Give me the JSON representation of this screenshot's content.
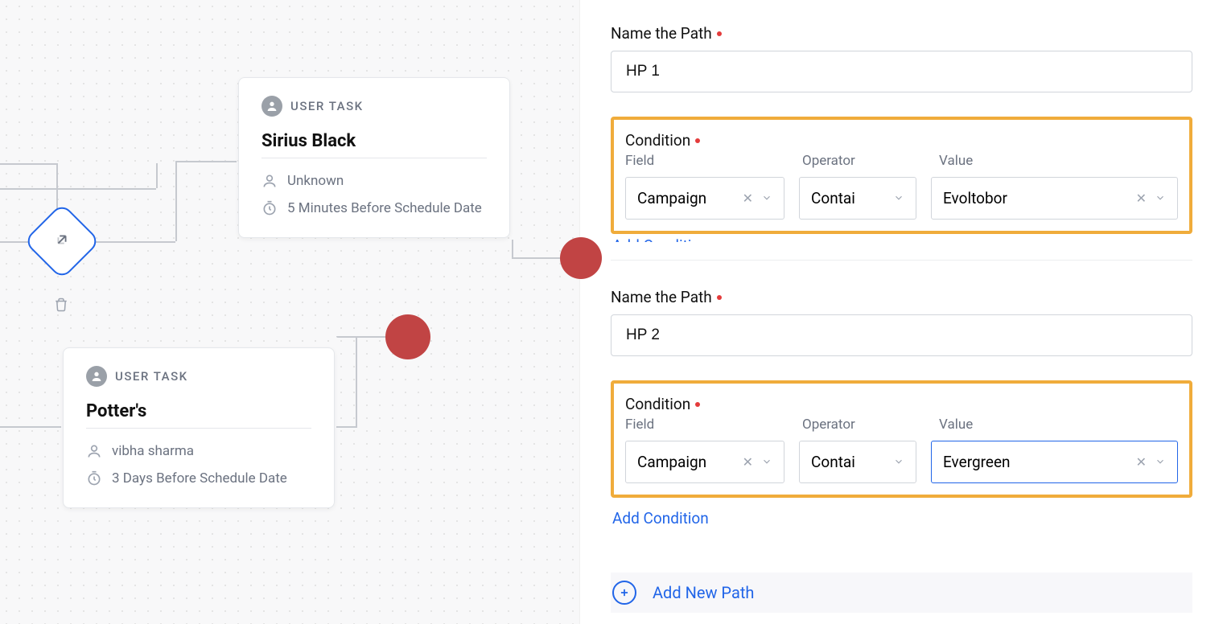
{
  "canvas": {
    "task1": {
      "type_label": "USER TASK",
      "title": "Sirius Black",
      "assignee": "Unknown",
      "timing": "5 Minutes Before Schedule Date"
    },
    "task2": {
      "type_label": "USER TASK",
      "title": "Potter's",
      "assignee": "vibha sharma",
      "timing": "3 Days Before Schedule Date"
    }
  },
  "panel": {
    "path_name_label": "Name the Path",
    "condition_label": "Condition",
    "field_col": "Field",
    "operator_col": "Operator",
    "value_col": "Value",
    "add_condition": "Add Condition",
    "add_new_path": "Add New Path",
    "path1": {
      "name": "HP 1",
      "field": "Campaign",
      "operator": "Contai",
      "value": "Evoltobor"
    },
    "path2": {
      "name": "HP 2",
      "field": "Campaign",
      "operator": "Contai",
      "value": "Evergreen"
    }
  }
}
